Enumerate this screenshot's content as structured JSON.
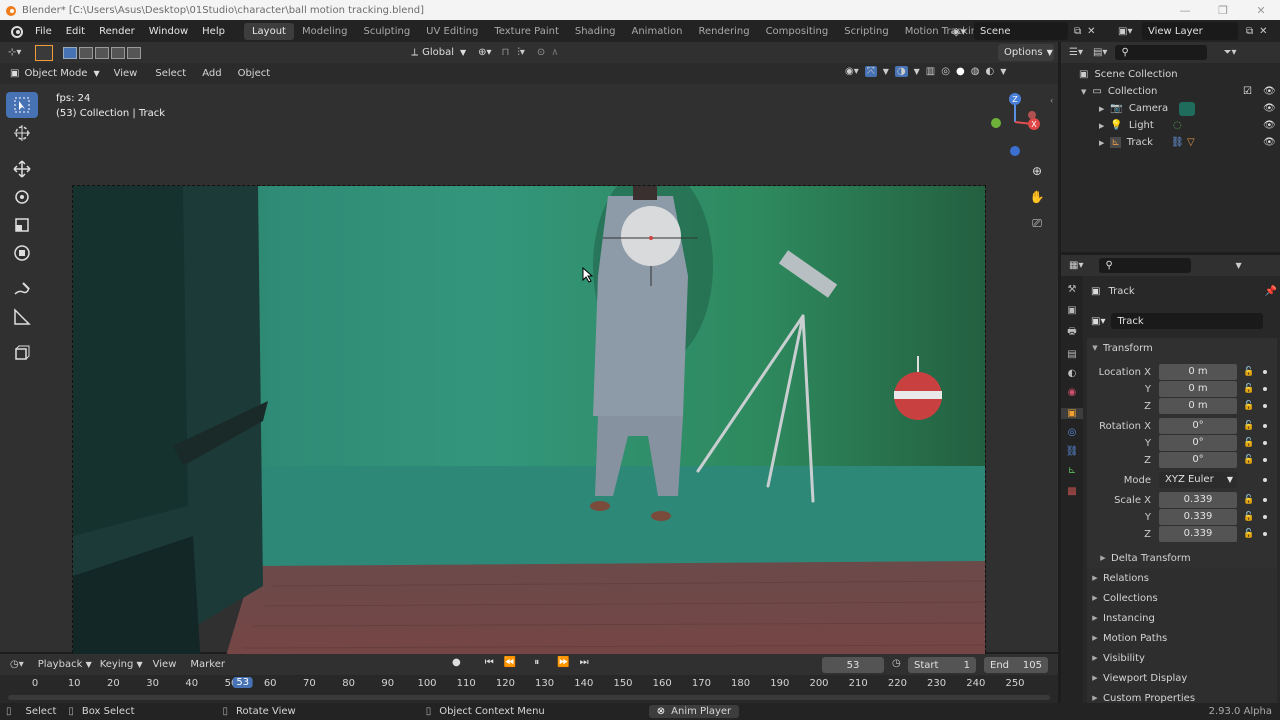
{
  "window": {
    "title": "Blender* [C:\\Users\\Asus\\Desktop\\01Studio\\character\\ball motion tracking.blend]"
  },
  "menu": [
    "File",
    "Edit",
    "Render",
    "Window",
    "Help"
  ],
  "workspaces": [
    "Layout",
    "Modeling",
    "Sculpting",
    "UV Editing",
    "Texture Paint",
    "Shading",
    "Animation",
    "Rendering",
    "Compositing",
    "Scripting",
    "Motion Tracking"
  ],
  "active_workspace": "Layout",
  "scene_name": "Scene",
  "view_layer": "View Layer",
  "toolbar": {
    "orientation": "Global",
    "options": "Options"
  },
  "viewport_header": {
    "mode": "Object Mode",
    "menus": [
      "View",
      "Select",
      "Add",
      "Object"
    ]
  },
  "viewport_overlay": {
    "fps": "fps: 24",
    "info": "(53) Collection | Track"
  },
  "outliner": {
    "root": "Scene Collection",
    "collection": "Collection",
    "items": [
      "Camera",
      "Light",
      "Track"
    ]
  },
  "properties": {
    "object_name": "Track",
    "datablock_name": "Track",
    "transform_title": "Transform",
    "location": {
      "label": "Location X",
      "x": "0 m",
      "y": "0 m",
      "z": "0 m"
    },
    "rotation": {
      "label": "Rotation X",
      "x": "0°",
      "y": "0°",
      "z": "0°"
    },
    "mode": {
      "label": "Mode",
      "value": "XYZ Euler"
    },
    "scale": {
      "label": "Scale X",
      "x": "0.339",
      "y": "0.339",
      "z": "0.339"
    },
    "axis_y": "Y",
    "axis_z": "Z",
    "delta": "Delta Transform",
    "panels": [
      "Relations",
      "Collections",
      "Instancing",
      "Motion Paths",
      "Visibility",
      "Viewport Display",
      "Custom Properties"
    ]
  },
  "timeline": {
    "menus": [
      "Playback",
      "Keying",
      "View",
      "Marker"
    ],
    "current_frame": "53",
    "start_label": "Start",
    "start": "1",
    "end_label": "End",
    "end": "105",
    "ticks": [
      "0",
      "10",
      "20",
      "30",
      "40",
      "50",
      "60",
      "70",
      "80",
      "90",
      "100",
      "110",
      "120",
      "130",
      "140",
      "150",
      "160",
      "170",
      "180",
      "190",
      "200",
      "210",
      "220",
      "230",
      "240",
      "250"
    ],
    "playhead_label": "53"
  },
  "statusbar": {
    "select": "Select",
    "box_select": "Box Select",
    "rotate": "Rotate View",
    "context": "Object Context Menu",
    "anim": "Anim Player",
    "version": "2.93.0 Alpha"
  },
  "colors": {
    "accent": "#4772b3",
    "panel": "#303030",
    "field": "#545454"
  }
}
